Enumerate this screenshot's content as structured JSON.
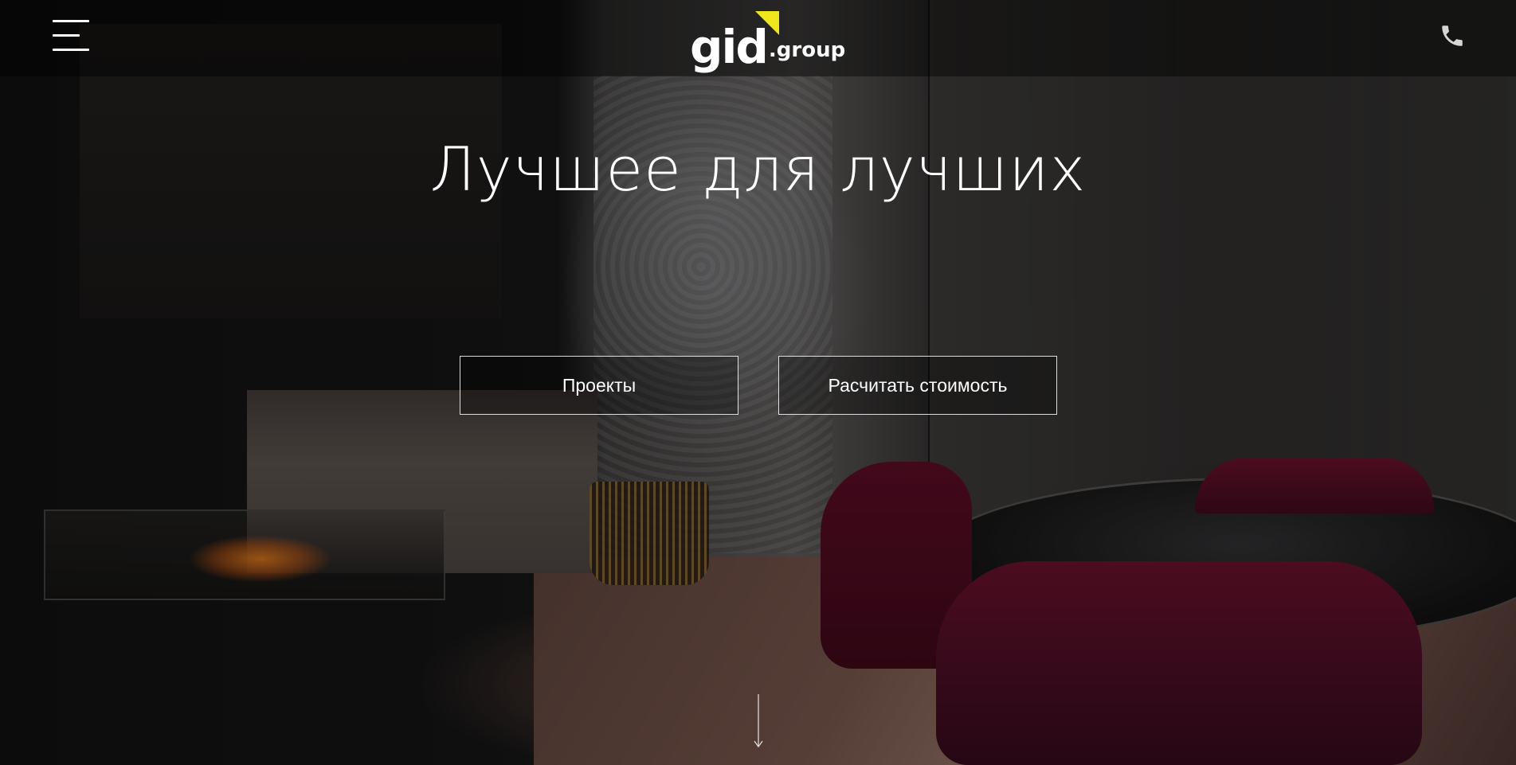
{
  "header": {
    "menu_icon": "hamburger-menu-icon",
    "logo": {
      "main": "gid",
      "suffix": ".group",
      "accent_color": "#f0e61e"
    },
    "phone_icon": "phone-icon"
  },
  "hero": {
    "title": "Лучшее для лучших",
    "buttons": {
      "projects_label": "Проекты",
      "calculate_label": "Расчитать стоимость"
    },
    "scroll_icon": "arrow-down-icon"
  },
  "colors": {
    "text": "#ffffff",
    "accent": "#f0e61e"
  }
}
